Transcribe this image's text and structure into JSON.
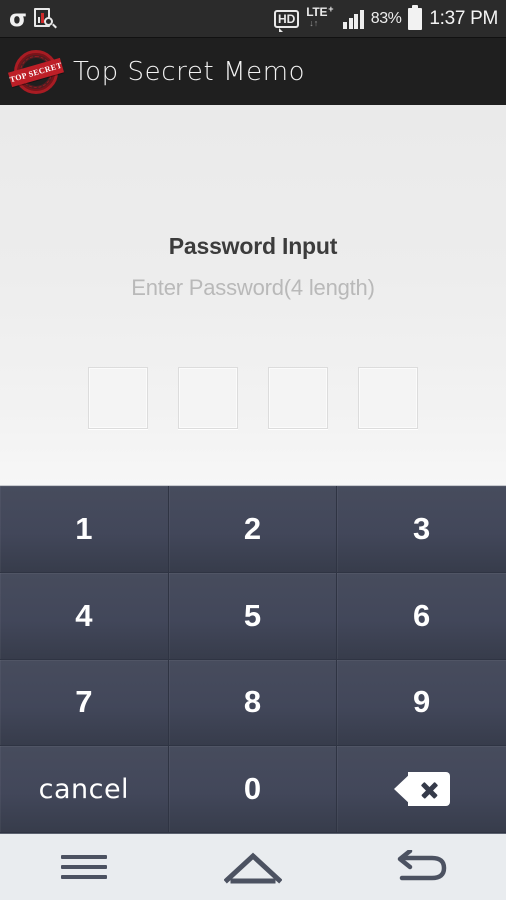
{
  "status_bar": {
    "left_icons": [
      {
        "name": "sigma-app-icon",
        "glyph": "σ"
      },
      {
        "name": "document-search-icon",
        "glyph": ""
      }
    ],
    "hd_label": "HD",
    "network_label": "LTE",
    "network_plus": "+",
    "network_arrows": "↓↑",
    "battery_percent": "83%",
    "time": "1:37 PM",
    "signal_bars": 4
  },
  "app_bar": {
    "logo_text": "TOP SECRET",
    "title": "Top Secret Memo"
  },
  "content": {
    "title": "Password Input",
    "subtitle": "Enter Password(4 length)",
    "password_boxes": [
      "",
      "",
      "",
      ""
    ]
  },
  "keypad": {
    "keys": [
      {
        "label": "1",
        "name": "key-1",
        "type": "num"
      },
      {
        "label": "2",
        "name": "key-2",
        "type": "num"
      },
      {
        "label": "3",
        "name": "key-3",
        "type": "num"
      },
      {
        "label": "4",
        "name": "key-4",
        "type": "num"
      },
      {
        "label": "5",
        "name": "key-5",
        "type": "num"
      },
      {
        "label": "6",
        "name": "key-6",
        "type": "num"
      },
      {
        "label": "7",
        "name": "key-7",
        "type": "num"
      },
      {
        "label": "8",
        "name": "key-8",
        "type": "num"
      },
      {
        "label": "9",
        "name": "key-9",
        "type": "num"
      },
      {
        "label": "cancel",
        "name": "key-cancel",
        "type": "cancel"
      },
      {
        "label": "0",
        "name": "key-0",
        "type": "num"
      },
      {
        "label": "",
        "name": "key-backspace",
        "type": "backspace"
      }
    ],
    "cancel_label": "cancel",
    "zero_label": "0"
  },
  "nav_bar": {
    "menu": "menu-icon",
    "home": "home-icon",
    "back": "back-icon"
  },
  "colors": {
    "status_bar_bg": "#2b2b2b",
    "app_bar_bg": "#1f1f1f",
    "content_bg": "#ededed",
    "keypad_bg": "#42475a",
    "key_text": "#ffffff",
    "nav_bg": "#e9ecef",
    "stamp_red": "#bd1f27",
    "title_text": "#3c3c3c",
    "subtitle_text": "#b9b9b9"
  }
}
